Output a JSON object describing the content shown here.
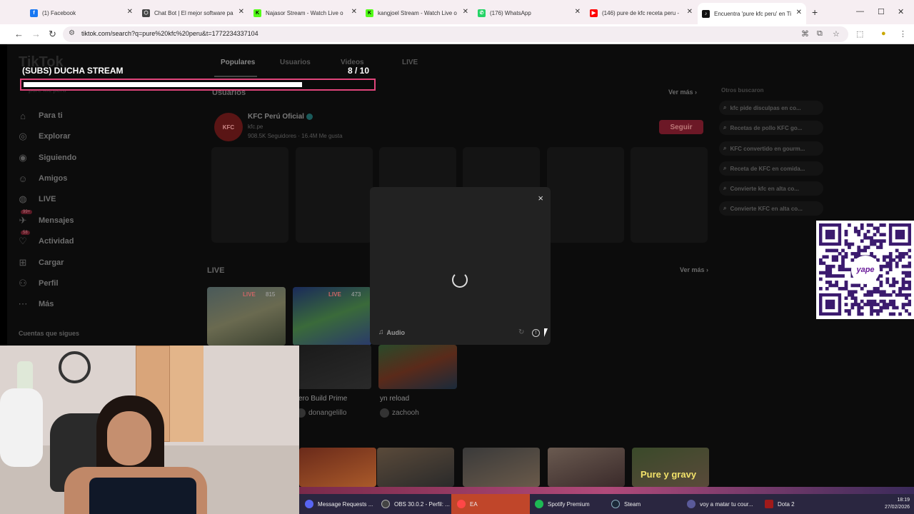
{
  "browser": {
    "tabs": [
      {
        "title": "(1) Facebook",
        "icon_color": "#1877f2",
        "icon": "facebook-icon"
      },
      {
        "title": "Chat Bot | El mejor software pa",
        "icon_color": "#444444",
        "icon": "chatbot-icon"
      },
      {
        "title": "Najasor Stream - Watch Live o",
        "icon_color": "#53fc18",
        "icon": "kick-icon"
      },
      {
        "title": "kangjoel Stream - Watch Live o",
        "icon_color": "#53fc18",
        "icon": "kick-icon"
      },
      {
        "title": "(176) WhatsApp",
        "icon_color": "#25d366",
        "icon": "whatsapp-icon"
      },
      {
        "title": "(146) pure de kfc receta peru -",
        "icon_color": "#ff0000",
        "icon": "youtube-icon"
      },
      {
        "title": "Encuentra 'pure kfc peru' en Ti",
        "icon_color": "#111111",
        "icon": "tiktok-icon"
      }
    ],
    "url": "tiktok.com/search?q=pure%20kfc%20peru&t=1772234337104"
  },
  "tiktok": {
    "logo": "TikTok",
    "search_value": "pure kfc peru",
    "nav": [
      {
        "label": "Para ti",
        "icon": "home-icon"
      },
      {
        "label": "Explorar",
        "icon": "compass-icon"
      },
      {
        "label": "Siguiendo",
        "icon": "following-icon"
      },
      {
        "label": "Amigos",
        "icon": "friends-icon"
      },
      {
        "label": "LIVE",
        "icon": "live-icon"
      },
      {
        "label": "Mensajes",
        "icon": "messages-icon",
        "badge": "99+"
      },
      {
        "label": "Actividad",
        "icon": "activity-icon",
        "badge": "58"
      },
      {
        "label": "Cargar",
        "icon": "upload-icon"
      },
      {
        "label": "Perfil",
        "icon": "profile-icon"
      },
      {
        "label": "Más",
        "icon": "more-icon"
      }
    ],
    "following_title": "Cuentas que sigues",
    "top_tabs": [
      "Populares",
      "Usuarios",
      "Videos",
      "LIVE"
    ],
    "users_section": {
      "title": "Usuarios",
      "more": "Ver más",
      "account": {
        "avatar_text": "KFC",
        "name": "KFC Perú Oficial",
        "url": "kfc.pe",
        "stats": "908.5K Seguidores · 16.4M Me gusta",
        "follow": "Seguir"
      }
    },
    "others": {
      "title": "Otros buscaron",
      "items": [
        "kfc pide disculpas en co...",
        "Recetas de pollo KFC go...",
        "KFC convertido en gourm...",
        "Receta de KFC en comida...",
        "Convierte kfc en alta co...",
        "Convierte KFC en alta co..."
      ]
    },
    "live_section": {
      "title": "LIVE",
      "more": "Ver más",
      "cards": [
        {
          "tag": "LIVE",
          "viewers": "815"
        },
        {
          "tag": "LIVE",
          "viewers": "473"
        }
      ],
      "videos": [
        {
          "title": "ero Build Prime",
          "user": "donangelillo"
        },
        {
          "title": "yn reload",
          "user": "zachooh"
        }
      ]
    },
    "bottom_thumb_text": "Pure y gravy"
  },
  "modal": {
    "close": "×",
    "audio_label": "Audio"
  },
  "overlay": {
    "title": "(SUBS) DUCHA STREAM",
    "count": "8  / 10",
    "progress_fraction": 0.8,
    "accent": "#e0457b",
    "qr_brand": "yape"
  },
  "taskbar": {
    "items": [
      {
        "label": "Message Requests ...",
        "color": "#5865f2"
      },
      {
        "label": "OBS 30.0.2 - Perfil: ...",
        "color": "#444444"
      },
      {
        "label": "EA",
        "color": "#ff4747",
        "active": true
      },
      {
        "label": "Spotify Premium",
        "color": "#1db954"
      },
      {
        "label": "Steam",
        "color": "#1b2838"
      },
      {
        "label": "voy a matar tu cour...",
        "color": "#5a5a9a"
      },
      {
        "label": "Dota 2",
        "color": "#a01a1a"
      }
    ],
    "time": "18:19",
    "date": "27/02/2026"
  }
}
